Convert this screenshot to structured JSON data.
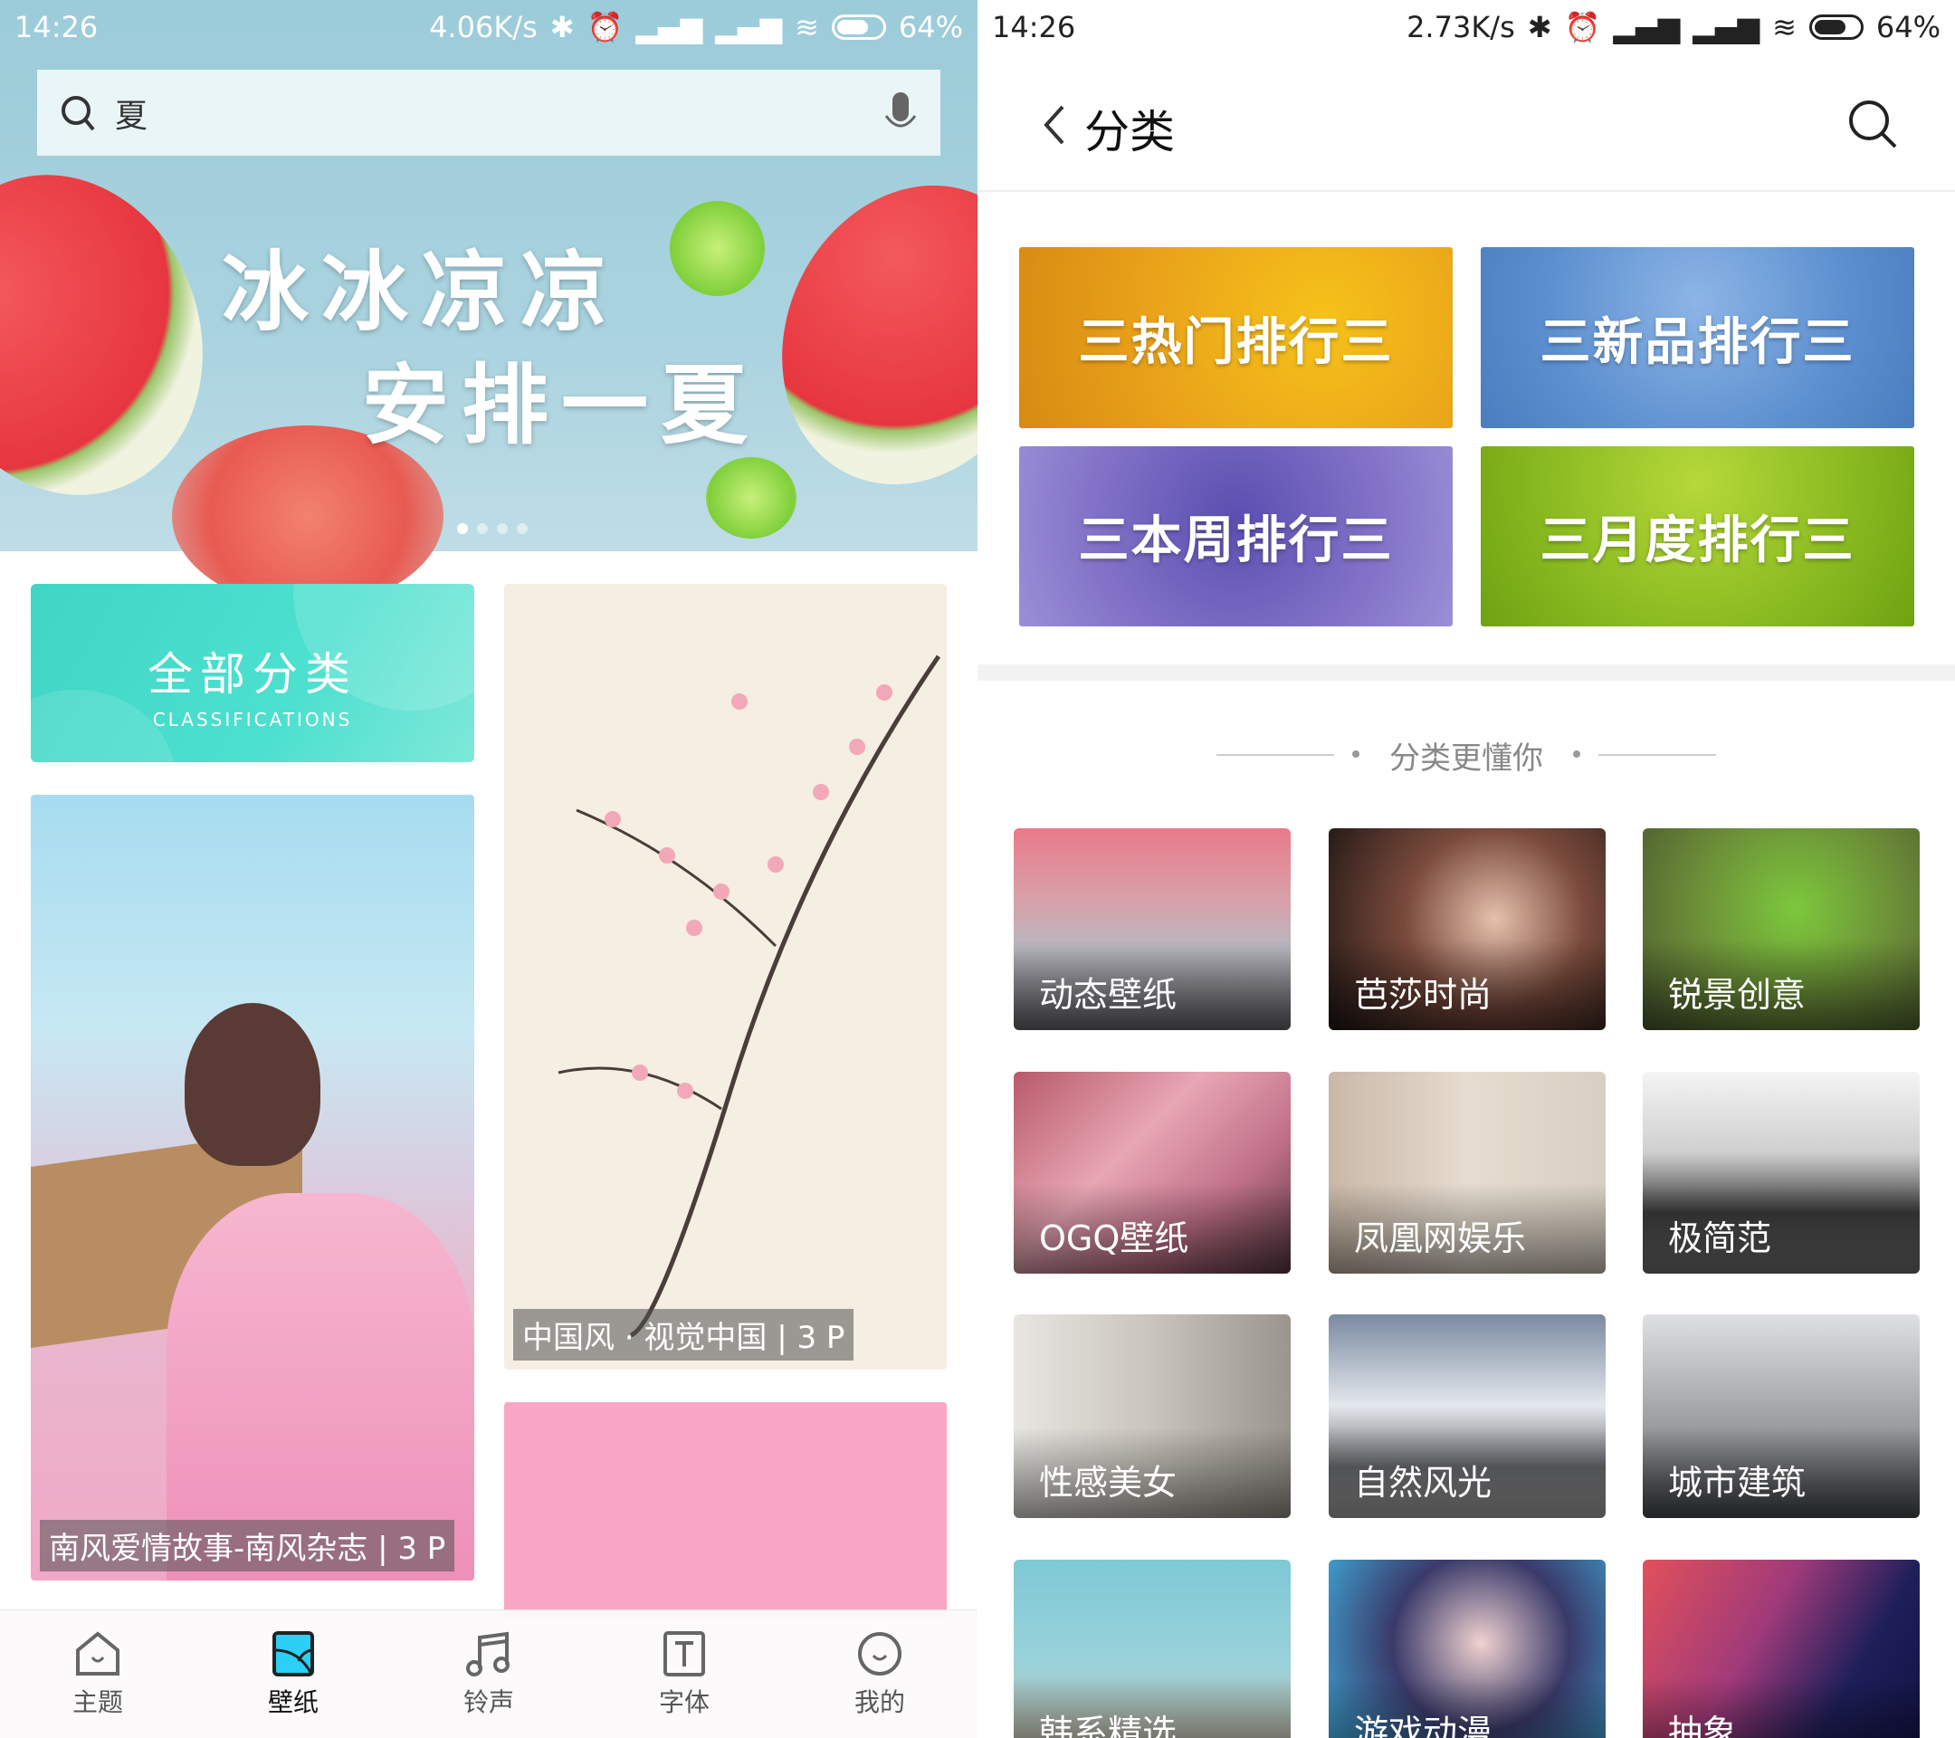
{
  "left": {
    "status": {
      "time": "14:26",
      "speed": "4.06K/s",
      "battery": "64%"
    },
    "search": {
      "value": "夏",
      "icon": "search-icon",
      "voice_icon": "microphone-icon"
    },
    "banner": {
      "line1": "冰冰凉凉",
      "line2": "安排一夏",
      "page_count": 4,
      "active_page": 0
    },
    "all_categories": {
      "title": "全部分类",
      "subtitle": "CLASSIFICATIONS"
    },
    "cards": [
      {
        "caption": "南风爱情故事-南风杂志 | 3 P"
      },
      {
        "caption": "中国风 · 视觉中国 | 3 P"
      },
      {
        "caption": ""
      }
    ],
    "nav": [
      {
        "label": "主题",
        "icon": "home-icon",
        "active": false
      },
      {
        "label": "壁纸",
        "icon": "wallpaper-icon",
        "active": true
      },
      {
        "label": "铃声",
        "icon": "music-note-icon",
        "active": false
      },
      {
        "label": "字体",
        "icon": "font-icon",
        "active": false
      },
      {
        "label": "我的",
        "icon": "smile-icon",
        "active": false
      }
    ],
    "accent": "#2ccff5"
  },
  "right": {
    "status": {
      "time": "14:26",
      "speed": "2.73K/s",
      "battery": "64%"
    },
    "header": {
      "title": "分类"
    },
    "rankings": [
      {
        "label": "热门排行",
        "color": "#e9a21a"
      },
      {
        "label": "新品排行",
        "color": "#5b8fcf"
      },
      {
        "label": "本周排行",
        "color": "#7f6fc6"
      },
      {
        "label": "月度排行",
        "color": "#8cbc22"
      }
    ],
    "section_title": "分类更懂你",
    "categories": [
      {
        "label": "动态壁纸"
      },
      {
        "label": "芭莎时尚"
      },
      {
        "label": "锐景创意"
      },
      {
        "label": "OGQ壁纸"
      },
      {
        "label": "凤凰网娱乐"
      },
      {
        "label": "极简范"
      },
      {
        "label": "性感美女"
      },
      {
        "label": "自然风光"
      },
      {
        "label": "城市建筑"
      },
      {
        "label": "韩系精选"
      },
      {
        "label": "游戏动漫"
      },
      {
        "label": "抽象"
      }
    ]
  }
}
